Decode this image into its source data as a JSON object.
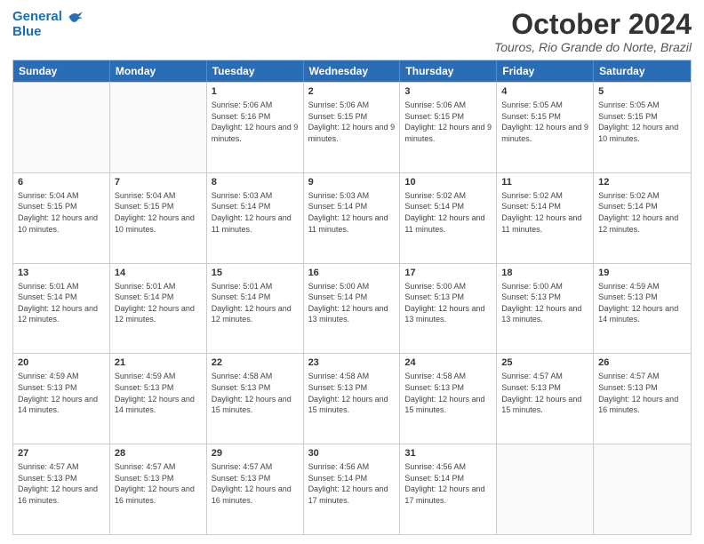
{
  "header": {
    "logo_line1": "General",
    "logo_line2": "Blue",
    "month": "October 2024",
    "location": "Touros, Rio Grande do Norte, Brazil"
  },
  "days": [
    "Sunday",
    "Monday",
    "Tuesday",
    "Wednesday",
    "Thursday",
    "Friday",
    "Saturday"
  ],
  "weeks": [
    [
      {
        "day": "",
        "info": ""
      },
      {
        "day": "",
        "info": ""
      },
      {
        "day": "1",
        "info": "Sunrise: 5:06 AM\nSunset: 5:16 PM\nDaylight: 12 hours and 9 minutes."
      },
      {
        "day": "2",
        "info": "Sunrise: 5:06 AM\nSunset: 5:15 PM\nDaylight: 12 hours and 9 minutes."
      },
      {
        "day": "3",
        "info": "Sunrise: 5:06 AM\nSunset: 5:15 PM\nDaylight: 12 hours and 9 minutes."
      },
      {
        "day": "4",
        "info": "Sunrise: 5:05 AM\nSunset: 5:15 PM\nDaylight: 12 hours and 9 minutes."
      },
      {
        "day": "5",
        "info": "Sunrise: 5:05 AM\nSunset: 5:15 PM\nDaylight: 12 hours and 10 minutes."
      }
    ],
    [
      {
        "day": "6",
        "info": "Sunrise: 5:04 AM\nSunset: 5:15 PM\nDaylight: 12 hours and 10 minutes."
      },
      {
        "day": "7",
        "info": "Sunrise: 5:04 AM\nSunset: 5:15 PM\nDaylight: 12 hours and 10 minutes."
      },
      {
        "day": "8",
        "info": "Sunrise: 5:03 AM\nSunset: 5:14 PM\nDaylight: 12 hours and 11 minutes."
      },
      {
        "day": "9",
        "info": "Sunrise: 5:03 AM\nSunset: 5:14 PM\nDaylight: 12 hours and 11 minutes."
      },
      {
        "day": "10",
        "info": "Sunrise: 5:02 AM\nSunset: 5:14 PM\nDaylight: 12 hours and 11 minutes."
      },
      {
        "day": "11",
        "info": "Sunrise: 5:02 AM\nSunset: 5:14 PM\nDaylight: 12 hours and 11 minutes."
      },
      {
        "day": "12",
        "info": "Sunrise: 5:02 AM\nSunset: 5:14 PM\nDaylight: 12 hours and 12 minutes."
      }
    ],
    [
      {
        "day": "13",
        "info": "Sunrise: 5:01 AM\nSunset: 5:14 PM\nDaylight: 12 hours and 12 minutes."
      },
      {
        "day": "14",
        "info": "Sunrise: 5:01 AM\nSunset: 5:14 PM\nDaylight: 12 hours and 12 minutes."
      },
      {
        "day": "15",
        "info": "Sunrise: 5:01 AM\nSunset: 5:14 PM\nDaylight: 12 hours and 12 minutes."
      },
      {
        "day": "16",
        "info": "Sunrise: 5:00 AM\nSunset: 5:14 PM\nDaylight: 12 hours and 13 minutes."
      },
      {
        "day": "17",
        "info": "Sunrise: 5:00 AM\nSunset: 5:13 PM\nDaylight: 12 hours and 13 minutes."
      },
      {
        "day": "18",
        "info": "Sunrise: 5:00 AM\nSunset: 5:13 PM\nDaylight: 12 hours and 13 minutes."
      },
      {
        "day": "19",
        "info": "Sunrise: 4:59 AM\nSunset: 5:13 PM\nDaylight: 12 hours and 14 minutes."
      }
    ],
    [
      {
        "day": "20",
        "info": "Sunrise: 4:59 AM\nSunset: 5:13 PM\nDaylight: 12 hours and 14 minutes."
      },
      {
        "day": "21",
        "info": "Sunrise: 4:59 AM\nSunset: 5:13 PM\nDaylight: 12 hours and 14 minutes."
      },
      {
        "day": "22",
        "info": "Sunrise: 4:58 AM\nSunset: 5:13 PM\nDaylight: 12 hours and 15 minutes."
      },
      {
        "day": "23",
        "info": "Sunrise: 4:58 AM\nSunset: 5:13 PM\nDaylight: 12 hours and 15 minutes."
      },
      {
        "day": "24",
        "info": "Sunrise: 4:58 AM\nSunset: 5:13 PM\nDaylight: 12 hours and 15 minutes."
      },
      {
        "day": "25",
        "info": "Sunrise: 4:57 AM\nSunset: 5:13 PM\nDaylight: 12 hours and 15 minutes."
      },
      {
        "day": "26",
        "info": "Sunrise: 4:57 AM\nSunset: 5:13 PM\nDaylight: 12 hours and 16 minutes."
      }
    ],
    [
      {
        "day": "27",
        "info": "Sunrise: 4:57 AM\nSunset: 5:13 PM\nDaylight: 12 hours and 16 minutes."
      },
      {
        "day": "28",
        "info": "Sunrise: 4:57 AM\nSunset: 5:13 PM\nDaylight: 12 hours and 16 minutes."
      },
      {
        "day": "29",
        "info": "Sunrise: 4:57 AM\nSunset: 5:13 PM\nDaylight: 12 hours and 16 minutes."
      },
      {
        "day": "30",
        "info": "Sunrise: 4:56 AM\nSunset: 5:14 PM\nDaylight: 12 hours and 17 minutes."
      },
      {
        "day": "31",
        "info": "Sunrise: 4:56 AM\nSunset: 5:14 PM\nDaylight: 12 hours and 17 minutes."
      },
      {
        "day": "",
        "info": ""
      },
      {
        "day": "",
        "info": ""
      }
    ]
  ]
}
